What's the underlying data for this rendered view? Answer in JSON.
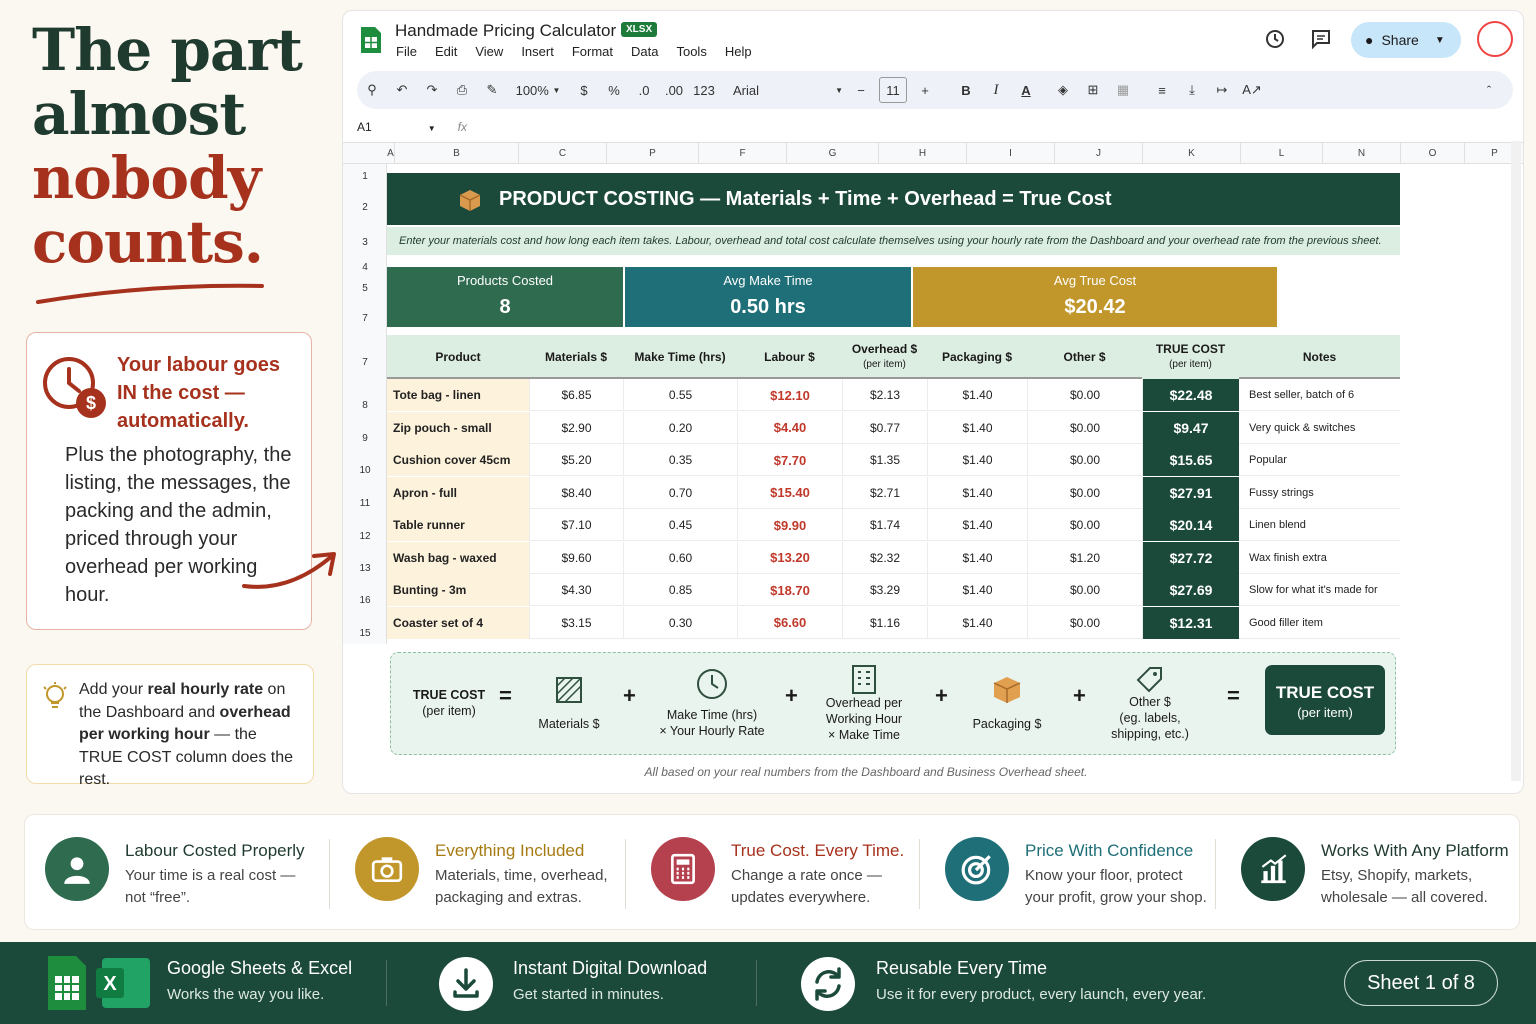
{
  "hero": {
    "line1": "The part",
    "line2": "almost",
    "line3": "nobody",
    "line4": "counts."
  },
  "labour_card": {
    "heading": "Your labour goes IN the cost — automatically.",
    "body": "Plus the photography, the listing, the messages, the packing and the admin, priced through your overhead per working hour."
  },
  "tip_card": {
    "pre": "Add your ",
    "b1": "real hourly rate",
    "mid1": " on the Dashboard and ",
    "b2": "overhead per working hour",
    "post": " — the TRUE COST column does the rest."
  },
  "app": {
    "title": "Handmade Pricing Calculator",
    "badge": "XLSX",
    "menu": [
      "File",
      "Edit",
      "View",
      "Insert",
      "Format",
      "Data",
      "Tools",
      "Help"
    ],
    "share": "Share",
    "toolbar": {
      "zoom": "100%",
      "currency": "$",
      "percent": "%",
      "dec_down": ".0",
      "dec_up": ".00",
      "format": "123",
      "font": "Arial",
      "font_size": "11"
    },
    "namebox": "A1",
    "fx": "fx"
  },
  "columns": [
    "A",
    "B",
    "C",
    "P",
    "F",
    "G",
    "H",
    "I",
    "J",
    "K",
    "L",
    "N",
    "O",
    "P"
  ],
  "rows": [
    "1",
    "2",
    "3",
    "4",
    "5",
    "7",
    "7",
    "8",
    "9",
    "10",
    "11",
    "12",
    "13",
    "16",
    "15"
  ],
  "sheet": {
    "banner": "PRODUCT COSTING — Materials + Time + Overhead = True Cost",
    "note": "Enter your materials cost and how long each item takes. Labour, overhead and total cost calculate themselves using your hourly rate from the Dashboard and your overhead rate from the previous sheet.",
    "stats": [
      {
        "label": "Products Costed",
        "value": "8",
        "color": "#2f6b4f"
      },
      {
        "label": "Avg Make Time",
        "value": "0.50 hrs",
        "color": "#1f6f78"
      },
      {
        "label": "Avg True Cost",
        "value": "$20.42",
        "color": "#c1962b"
      }
    ],
    "headers": [
      "Product",
      "Materials $",
      "Make Time (hrs)",
      "Labour $",
      "Overhead $",
      "Packaging $",
      "Other $",
      "TRUE COST",
      "Notes"
    ],
    "header_sub": {
      "overhead": "(per item)",
      "true_cost": "(per item)"
    },
    "table": [
      [
        "Tote bag - linen",
        "$6.85",
        "0.55",
        "$12.10",
        "$2.13",
        "$1.40",
        "$0.00",
        "$22.48",
        "Best seller, batch of 6"
      ],
      [
        "Zip pouch - small",
        "$2.90",
        "0.20",
        "$4.40",
        "$0.77",
        "$1.40",
        "$0.00",
        "$9.47",
        "Very quick & switches"
      ],
      [
        "Cushion cover 45cm",
        "$5.20",
        "0.35",
        "$7.70",
        "$1.35",
        "$1.40",
        "$0.00",
        "$15.65",
        "Popular"
      ],
      [
        "Apron - full",
        "$8.40",
        "0.70",
        "$15.40",
        "$2.71",
        "$1.40",
        "$0.00",
        "$27.91",
        "Fussy strings"
      ],
      [
        "Table runner",
        "$7.10",
        "0.45",
        "$9.90",
        "$1.74",
        "$1.40",
        "$0.00",
        "$20.14",
        "Linen blend"
      ],
      [
        "Wash bag - waxed",
        "$9.60",
        "0.60",
        "$13.20",
        "$2.32",
        "$1.40",
        "$1.20",
        "$27.72",
        "Wax finish extra"
      ],
      [
        "Bunting - 3m",
        "$4.30",
        "0.85",
        "$18.70",
        "$3.29",
        "$1.40",
        "$0.00",
        "$27.69",
        "Slow for what it's made for"
      ],
      [
        "Coaster set of 4",
        "$3.15",
        "0.30",
        "$6.60",
        "$1.16",
        "$1.40",
        "$0.00",
        "$12.31",
        "Good filler item"
      ]
    ],
    "formula": {
      "left_title": "TRUE COST",
      "left_sub": "(per item)",
      "eq": "=",
      "plus": "+",
      "materials": "Materials $",
      "time_l1": "Make Time (hrs)",
      "time_l2": "× Your Hourly Rate",
      "over_l1": "Overhead per",
      "over_l2": "Working Hour",
      "over_l3": "× Make Time",
      "packaging": "Packaging $",
      "other_l1": "Other $",
      "other_l2": "(eg. labels,",
      "other_l3": "shipping, etc.)",
      "result_title": "TRUE COST",
      "result_sub": "(per item)"
    },
    "formula_note": "All based on your real numbers from the Dashboard and Business Overhead sheet."
  },
  "features": [
    {
      "title": "Labour Costed Properly",
      "desc": "Your time is a real cost — not “free”.",
      "color": "#2f6b4f",
      "title_color": "#1f3a2e",
      "icon": "person-icon"
    },
    {
      "title": "Everything Included",
      "desc": "Materials, time, overhead, packaging and extras.",
      "color": "#c1962b",
      "title_color": "#a77b14",
      "icon": "camera-icon"
    },
    {
      "title": "True Cost. Every Time.",
      "desc": "Change a rate once — updates everywhere.",
      "color": "#b5404e",
      "title_color": "#a6321d",
      "icon": "calculator-icon"
    },
    {
      "title": "Price With Confidence",
      "desc": "Know your floor, protect your profit, grow your shop.",
      "color": "#1f6f78",
      "title_color": "#1f6f78",
      "icon": "target-icon"
    },
    {
      "title": "Works With Any Platform",
      "desc": "Etsy, Shopify, markets, wholesale — all covered.",
      "color": "#1c4a3a",
      "title_color": "#1f3a2e",
      "icon": "chart-icon"
    }
  ],
  "footer": [
    {
      "title": "Google Sheets & Excel",
      "desc": "Works the way you like."
    },
    {
      "title": "Instant Digital Download",
      "desc": "Get started in minutes."
    },
    {
      "title": "Reusable Every Time",
      "desc": "Use it for every product, every launch, every year."
    }
  ],
  "sheet_pill": "Sheet 1 of 8"
}
